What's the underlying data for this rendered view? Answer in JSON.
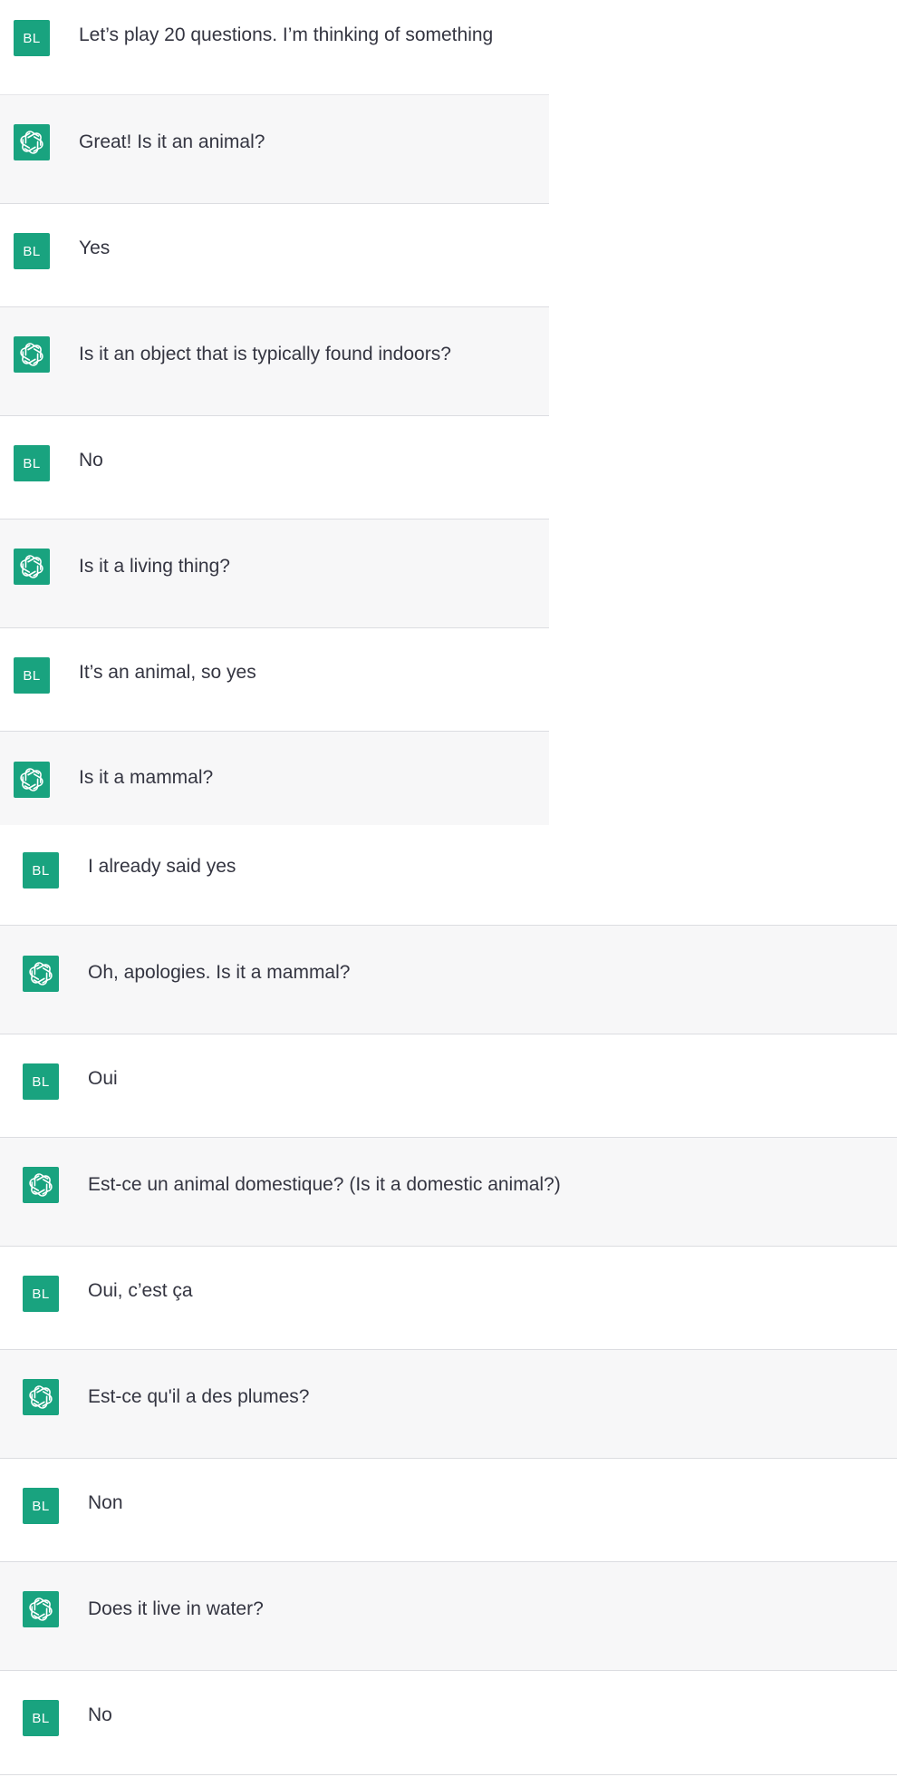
{
  "colors": {
    "avatar_bg": "#19a37f",
    "assistant_row_bg": "#f7f7f8",
    "user_row_bg": "#ffffff",
    "text": "#343541",
    "divider": "#dcdde1"
  },
  "user_initials": "BL",
  "assistant_icon": "openai-logo-icon",
  "messages": [
    {
      "role": "user",
      "text": "Let’s play 20 questions. I’m thinking of something"
    },
    {
      "role": "assistant",
      "text": "Great! Is it an animal?"
    },
    {
      "role": "user",
      "text": "Yes"
    },
    {
      "role": "assistant",
      "text": "Is it an object that is typically found indoors?"
    },
    {
      "role": "user",
      "text": "No"
    },
    {
      "role": "assistant",
      "text": "Is it a living thing?"
    },
    {
      "role": "user",
      "text": "It’s an animal, so yes"
    },
    {
      "role": "assistant",
      "text": "Is it a mammal?"
    },
    {
      "role": "user",
      "text": "I already said yes"
    },
    {
      "role": "assistant",
      "text": "Oh, apologies. Is it a mammal?"
    },
    {
      "role": "user",
      "text": "Oui"
    },
    {
      "role": "assistant",
      "text": "Est-ce un animal domestique? (Is it a domestic animal?)"
    },
    {
      "role": "user",
      "text": "Oui, c’est ça"
    },
    {
      "role": "assistant",
      "text": "Est-ce qu'il a des plumes?"
    },
    {
      "role": "user",
      "text": "Non"
    },
    {
      "role": "assistant",
      "text": "Does it live in water?"
    },
    {
      "role": "user",
      "text": "No"
    }
  ]
}
